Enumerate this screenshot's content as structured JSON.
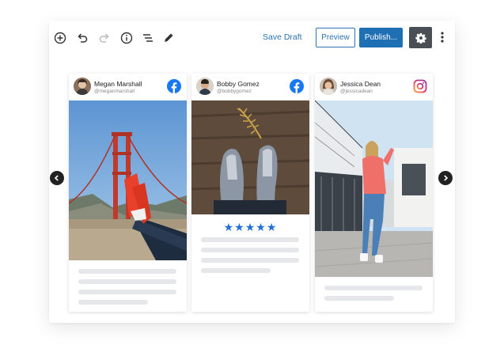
{
  "toolbar": {
    "icons": [
      "add-icon",
      "undo-icon",
      "redo-icon",
      "info-icon",
      "outline-icon",
      "edit-icon"
    ],
    "save_draft_label": "Save Draft",
    "preview_label": "Preview",
    "publish_label": "Publish...",
    "settings_icon": "gear-icon",
    "more_icon": "more-vertical-icon"
  },
  "carousel": {
    "prev_icon": "chevron-left-icon",
    "next_icon": "chevron-right-icon"
  },
  "cards": [
    {
      "name": "Megan Marshall",
      "handle": "@meganmarshall",
      "network": "facebook",
      "network_icon": "facebook-icon",
      "photo": "golden-gate-bridge-red-sneakers"
    },
    {
      "name": "Bobby Gomez",
      "handle": "@bobbygomez",
      "network": "facebook",
      "network_icon": "facebook-icon",
      "photo": "grey-sneakers-on-wood",
      "stars": "★★★★★"
    },
    {
      "name": "Jessica Dean",
      "handle": "@jessicadean",
      "network": "instagram",
      "network_icon": "instagram-icon",
      "photo": "woman-pink-shirt-street"
    }
  ],
  "colors": {
    "accent": "#2c74b3",
    "publish": "#1f6fb5",
    "facebook": "#1877f2",
    "star": "#1f6fd6",
    "placeholder": "#e6e7ea"
  }
}
